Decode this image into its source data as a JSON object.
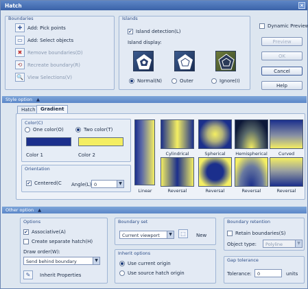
{
  "window": {
    "title": "Hatch",
    "close": "×"
  },
  "boundaries": {
    "title": "Boundaries",
    "items": [
      {
        "label": "Add: Pick points",
        "icon": "pick-points-icon",
        "enabled": true
      },
      {
        "label": "Add: Select objects",
        "icon": "select-objects-icon",
        "enabled": true
      },
      {
        "label": "Remove boundaries(D)",
        "icon": "remove-boundaries-icon",
        "enabled": false
      },
      {
        "label": "Recreate boundary(R)",
        "icon": "recreate-boundary-icon",
        "enabled": false
      },
      {
        "label": "View Selections(V)",
        "icon": "view-selections-icon",
        "enabled": false
      }
    ]
  },
  "islands": {
    "title": "Islands",
    "detection_label": "Island detection(L)",
    "display_label": "Island display:",
    "options": [
      {
        "label": "Normal(N)",
        "selected": true
      },
      {
        "label": "Outer",
        "selected": false
      },
      {
        "label": "Ignore(I)",
        "selected": false
      }
    ]
  },
  "side_buttons": {
    "dynamic_preview": "Dynamic Preview",
    "preview": "Preview",
    "ok": "OK",
    "cancel": "Cancel",
    "help": "Help"
  },
  "style_option": {
    "bar_label": "Style option",
    "collapse_glyph": "▲",
    "tabs": [
      "Hatch",
      "Gradient"
    ],
    "active_tab": "Gradient",
    "color": {
      "title": "Color(C)",
      "one_color": "One color(O)",
      "two_color": "Two color(T)",
      "color1_label": "Color 1",
      "color2_label": "Color 2",
      "color1": "#1b2f8c",
      "color2": "#f4ee62"
    },
    "orientation": {
      "title": "Orientation",
      "centered": "Centered(C",
      "angle_label": "Angle(L)",
      "angle_value": "0"
    },
    "patterns": [
      "Linear",
      "Cylindrical",
      "Spherical",
      "Hemispherical",
      "Curved",
      "Reversal",
      "Reversal",
      "Reversal",
      "Reversal"
    ]
  },
  "other_option": {
    "bar_label": "Other option",
    "collapse_glyph": "▲",
    "options": {
      "title": "Options",
      "associative": "Associative(A)",
      "separate": "Create separate hatch(H)",
      "draw_order_label": "Draw order(W):",
      "draw_order_value": "Send behind boundary",
      "inherit": "Inherit Properties"
    },
    "boundary_set": {
      "title": "Boundary set",
      "value": "Current viewport",
      "new_label": "New"
    },
    "inherit_options": {
      "title": "Inherit options",
      "use_current": "Use current origin",
      "use_source": "Use source hatch origin"
    },
    "boundary_retention": {
      "title": "Boundary retention",
      "retain": "Retain boundaries(S)",
      "object_type_label": "Object type:",
      "object_type_value": "Polyline"
    },
    "gap_tolerance": {
      "title": "Gap tolerance",
      "tolerance_label": "Tolerance:",
      "value": "0",
      "units": "units"
    }
  }
}
